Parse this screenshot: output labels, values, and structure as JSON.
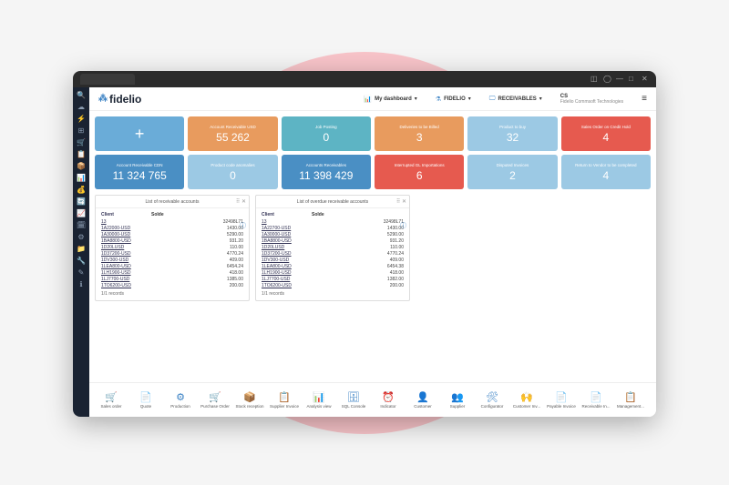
{
  "logo": "fidelio",
  "header": {
    "dashboard": {
      "label": "My dashboard"
    },
    "org": {
      "label": "FIDELIO"
    },
    "module": {
      "label": "RECEIVABLES"
    },
    "user": {
      "code": "CS",
      "company": "Fidelio Commsoft Technologies"
    }
  },
  "cards": [
    {
      "title": "",
      "value": "+",
      "cls": "c-blue"
    },
    {
      "title": "Account Receivable USD",
      "value": "55 262",
      "cls": "c-orange"
    },
    {
      "title": "Job Posting",
      "value": "0",
      "cls": "c-teal"
    },
    {
      "title": "Deliveries to be Billed",
      "value": "3",
      "cls": "c-orange"
    },
    {
      "title": "Product to buy",
      "value": "32",
      "cls": "c-ltblue"
    },
    {
      "title": "Sales Order on Credit Hold",
      "value": "4",
      "cls": "c-red"
    },
    {
      "title": "Account Receivable CDN",
      "value": "11 324 765",
      "cls": "c-dblue"
    },
    {
      "title": "Product code anomalies",
      "value": "0",
      "cls": "c-ltblue"
    },
    {
      "title": "Accounts Receivables",
      "value": "11 398 429",
      "cls": "c-dblue"
    },
    {
      "title": "Interrupted GL Importations",
      "value": "6",
      "cls": "c-red"
    },
    {
      "title": "Disputed Invoices",
      "value": "2",
      "cls": "c-ltblue"
    },
    {
      "title": "Return to Vendor to be completed",
      "value": "4",
      "cls": "c-ltblue"
    }
  ],
  "panels": [
    {
      "title": "List of receivable accounts",
      "col1": "Client",
      "col2": "Solde",
      "rows": [
        {
          "c": "13",
          "v": "32498L71"
        },
        {
          "c": "1A22000-USD",
          "v": "1430.00"
        },
        {
          "c": "1A30000-USD",
          "v": "5290.00"
        },
        {
          "c": "1BA8800-USD",
          "v": "931.20"
        },
        {
          "c": "1D20LUSD",
          "v": "110.00"
        },
        {
          "c": "1D37200-USD",
          "v": "4770.24"
        },
        {
          "c": "1DV300-USD",
          "v": "409.00"
        },
        {
          "c": "1LEA800-USD",
          "v": "6454.24"
        },
        {
          "c": "1LH1900-USD",
          "v": "418.00"
        },
        {
          "c": "1LJ7700-USD",
          "v": "1385.00"
        },
        {
          "c": "1TO6200-USD",
          "v": "200.00"
        }
      ],
      "footer": "1/1 records"
    },
    {
      "title": "List of overdue receivable accounts",
      "col1": "Client",
      "col2": "Solde",
      "rows": [
        {
          "c": "13",
          "v": "32498L71"
        },
        {
          "c": "1A22700-USD",
          "v": "1430.00"
        },
        {
          "c": "1A30000-USD",
          "v": "5290.00"
        },
        {
          "c": "1BA8800-USD",
          "v": "931.20"
        },
        {
          "c": "1D20LUSD",
          "v": "110.00"
        },
        {
          "c": "1D37200-USD",
          "v": "4770.24"
        },
        {
          "c": "1DV300-USD",
          "v": "409.00"
        },
        {
          "c": "1LEA800-USD",
          "v": "6454.38"
        },
        {
          "c": "1LH1900-USD",
          "v": "418.00"
        },
        {
          "c": "1LJ7700-USD",
          "v": "1382.00"
        },
        {
          "c": "1TO6200-USD",
          "v": "200.00"
        }
      ],
      "footer": "1/1 records"
    }
  ],
  "tools": [
    {
      "icon": "🛒",
      "label": "Sales order"
    },
    {
      "icon": "📄",
      "label": "Quote"
    },
    {
      "icon": "⚙",
      "label": "Production"
    },
    {
      "icon": "🛒",
      "label": "Purchase Order"
    },
    {
      "icon": "📦",
      "label": "Stock reception"
    },
    {
      "icon": "📋",
      "label": "Supplier Invoice"
    },
    {
      "icon": "📊",
      "label": "Analysis view"
    },
    {
      "icon": "🗄",
      "label": "SQL Console"
    },
    {
      "icon": "⏰",
      "label": "Indicator"
    },
    {
      "icon": "👤",
      "label": "Customer"
    },
    {
      "icon": "👥",
      "label": "Supplier"
    },
    {
      "icon": "🛠",
      "label": "Configurator"
    },
    {
      "icon": "🙌",
      "label": "Customer Inv..."
    },
    {
      "icon": "📄",
      "label": "Payable Invoice"
    },
    {
      "icon": "📄",
      "label": "Receivable In..."
    },
    {
      "icon": "📋",
      "label": "Management..."
    }
  ],
  "sidebar_icons": [
    "🔍",
    "☁",
    "⚡",
    "⊞",
    "🛒",
    "📋",
    "📦",
    "📊",
    "💰",
    "🔄",
    "📈",
    "🗓",
    "⚙",
    "📁",
    "🔧",
    "✎",
    "ℹ"
  ]
}
